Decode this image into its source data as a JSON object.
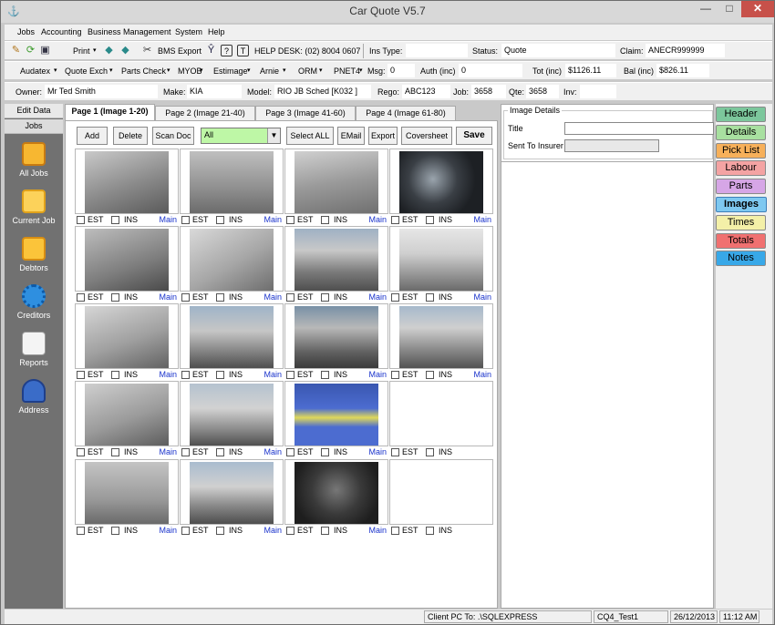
{
  "window": {
    "title": "Car Quote V5.7",
    "minimize": "—",
    "maximize": "□",
    "close": "✕"
  },
  "menu": [
    "Jobs",
    "Accounting",
    "Business Management",
    "System",
    "Help"
  ],
  "toolbar1": {
    "print": "Print",
    "bms_export": "BMS Export",
    "help_desk": "HELP DESK: (02) 8004 0607",
    "ins_type_label": "Ins Type:",
    "ins_type_value": "",
    "status_label": "Status:",
    "status_value": "Quote",
    "claim_label": "Claim:",
    "claim_value": "ANECR999999"
  },
  "toolbar2": {
    "audatex": "Audatex",
    "quote_exch": "Quote Exch",
    "parts_check": "Parts Check",
    "myob": "MYOB",
    "estimage": "Estimage",
    "arnie": "Arnie",
    "orm": "ORM",
    "pnet4": "PNET4",
    "msg_label": "Msg:",
    "msg_value": "0",
    "auth_label": "Auth (inc)",
    "auth_value": "0",
    "tot_label": "Tot (inc)",
    "tot_value": "$1126.11",
    "bal_label": "Bal (inc)",
    "bal_value": "$826.11"
  },
  "toolbar3": {
    "owner_label": "Owner:",
    "owner_value": "Mr Ted Smith",
    "make_label": "Make:",
    "make_value": "KIA",
    "model_label": "Model:",
    "model_value": "RIO JB Sched [K032    ]",
    "rego_label": "Rego:",
    "rego_value": "ABC123",
    "job_label": "Job:",
    "job_value": "3658",
    "qte_label": "Qte:",
    "qte_value": "3658",
    "inv_label": "Inv:",
    "inv_value": ""
  },
  "leftnav": {
    "edit_data": "Edit Data",
    "jobs_header": "Jobs",
    "items": [
      {
        "label": "All Jobs",
        "icon": "magnifier-icon"
      },
      {
        "label": "Current Job",
        "icon": "folder-icon"
      },
      {
        "label": "Debtors",
        "icon": "folder-pen-icon"
      },
      {
        "label": "Creditors",
        "icon": "gear-icon"
      },
      {
        "label": "Reports",
        "icon": "documents-icon"
      },
      {
        "label": "Address",
        "icon": "person-phone-icon"
      }
    ]
  },
  "tabs": [
    "Page 1 (Image 1-20)",
    "Page 2 (Image 21-40)",
    "Page 3 (Image 41-60)",
    "Page 4 (Image 61-80)"
  ],
  "image_buttons": {
    "add": "Add",
    "delete": "Delete",
    "scan_doc": "Scan Doc",
    "filter_value": "All",
    "select_all": "Select ALL",
    "email": "EMail",
    "export": "Export",
    "coversheet": "Coversheet",
    "save": "Save"
  },
  "thumb_labels": {
    "est": "EST",
    "ins": "INS",
    "main": "Main"
  },
  "image_details": {
    "legend": "Image Details",
    "title_label": "Title",
    "sent_label": "Sent To Insurer"
  },
  "right_tabs": [
    {
      "label": "Header",
      "color": "#7cc79c"
    },
    {
      "label": "Details",
      "color": "#a8e0a0"
    },
    {
      "label": "Pick List",
      "color": "#f7b05a"
    },
    {
      "label": "Labour",
      "color": "#f4a3a3"
    },
    {
      "label": "Parts",
      "color": "#d6a6e6"
    },
    {
      "label": "Images",
      "color": "#7ec8f0"
    },
    {
      "label": "Times",
      "color": "#f4f0a8"
    },
    {
      "label": "Totals",
      "color": "#f07070"
    },
    {
      "label": "Notes",
      "color": "#38a8e8"
    }
  ],
  "statusbar": {
    "client_pc": "Client PC To: .\\SQLEXPRESS",
    "db": "CQ4_Test1",
    "date": "26/12/2013",
    "time": "11:12 AM"
  }
}
